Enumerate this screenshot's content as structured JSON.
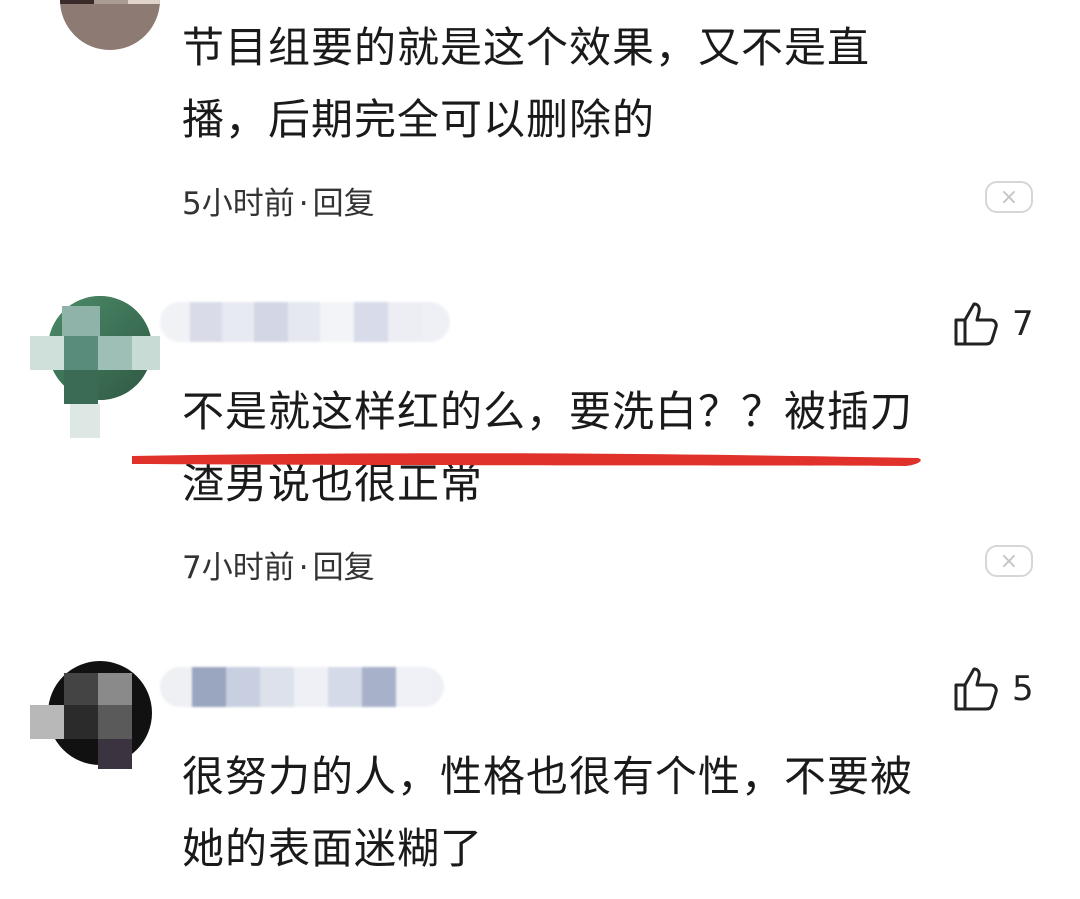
{
  "comments": [
    {
      "text_line1": "节目组要的就是这个效果，又不是直",
      "text_line2": "播，后期完全可以删除的",
      "time": "5小时前",
      "reply": "回复",
      "close": "×"
    },
    {
      "likes": "7",
      "text_line1": "不是就这样红的么，要洗白？？被插刀",
      "text_line2": "渣男说也很正常",
      "time": "7小时前",
      "reply": "回复",
      "close": "×"
    },
    {
      "likes": "5",
      "text_line1": "很努力的人，性格也很有个性，不要被",
      "text_line2": "她的表面迷糊了"
    }
  ],
  "colors": {
    "highlight_underline": "#e0322a",
    "text": "#1a1a1a",
    "meta": "#333333",
    "close_border": "#d6d6d6"
  },
  "icons": {
    "like": "thumbs-up-icon",
    "close": "close-icon"
  }
}
